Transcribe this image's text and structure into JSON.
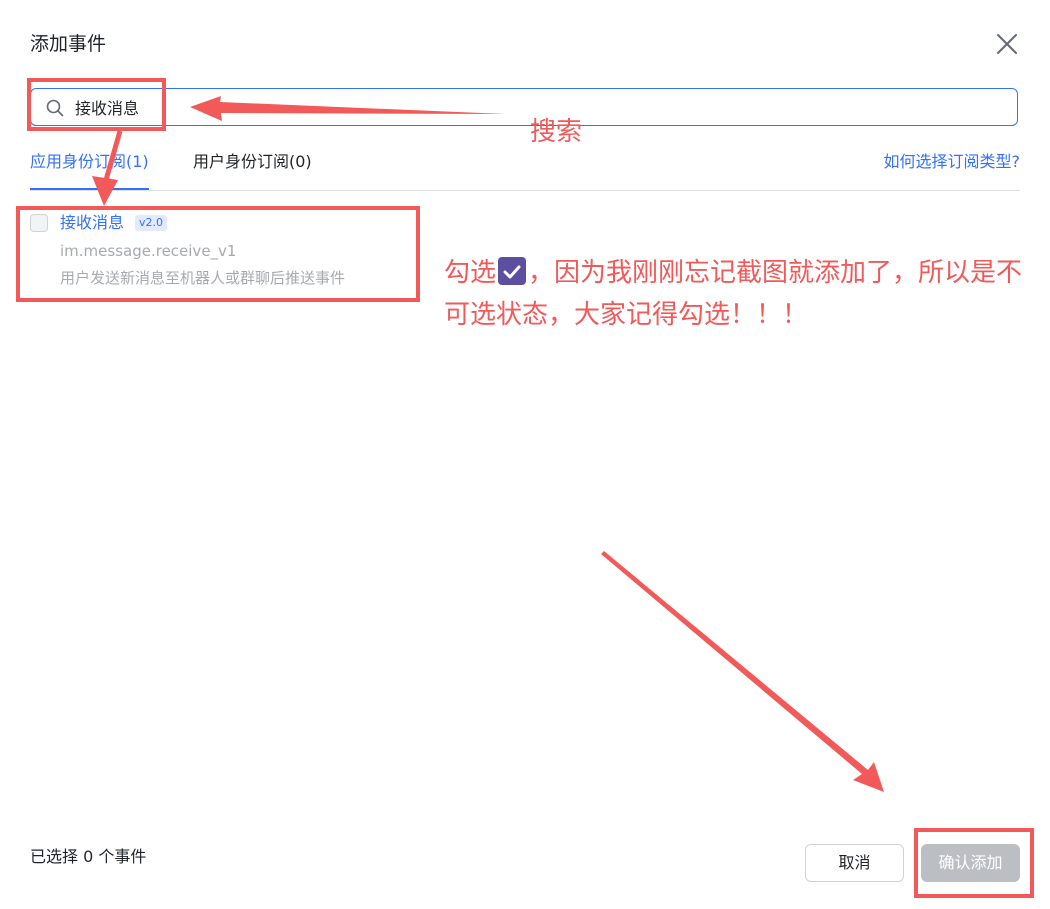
{
  "dialog": {
    "title": "添加事件"
  },
  "search": {
    "value": "接收消息",
    "placeholder": ""
  },
  "tabs": [
    {
      "label": "应用身份订阅(1)",
      "active": true
    },
    {
      "label": "用户身份订阅(0)",
      "active": false
    }
  ],
  "help_link": "如何选择订阅类型?",
  "events": [
    {
      "name": "接收消息",
      "version": "v2.0",
      "key": "im.message.receive_v1",
      "description": "用户发送新消息至机器人或群聊后推送事件",
      "checked": false,
      "disabled": true
    }
  ],
  "footer": {
    "selected_count": "已选择 0 个事件",
    "cancel_label": "取消",
    "confirm_label": "确认添加"
  },
  "annotations": {
    "search_label": "搜索",
    "note_before": "勾选",
    "note_after": "，因为我刚刚忘记截图就添加了，所以是不可选状态，大家记得勾选！！！"
  },
  "colors": {
    "primary": "#3370ff",
    "annotation": "#f25959",
    "disabled_text": "#a6aaaf",
    "disabled_button": "#bbbfc4"
  }
}
